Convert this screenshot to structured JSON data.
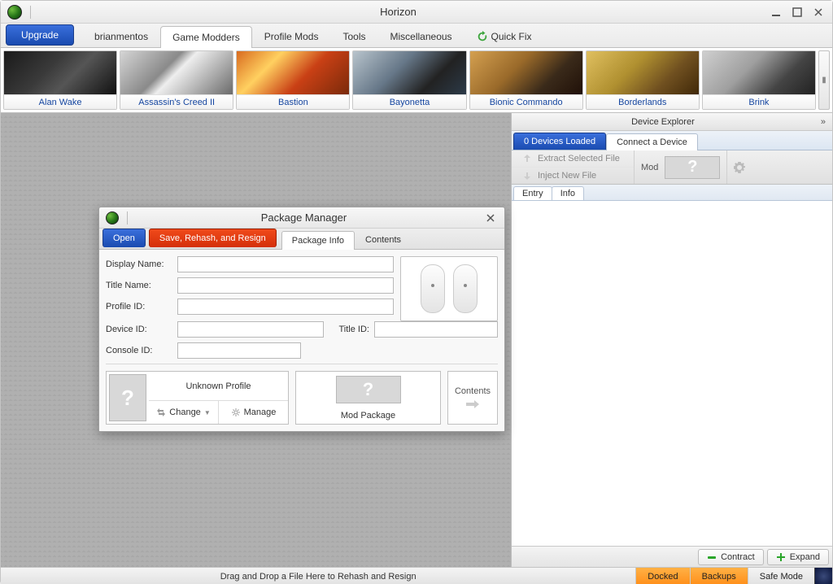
{
  "window": {
    "title": "Horizon"
  },
  "main_tabs": {
    "upgrade": "Upgrade",
    "items": [
      "brianmentos",
      "Game Modders",
      "Profile Mods",
      "Tools",
      "Miscellaneous"
    ],
    "quickfix": "Quick Fix",
    "active_index": 1
  },
  "games": [
    {
      "label": "Alan Wake"
    },
    {
      "label": "Assassin's Creed II"
    },
    {
      "label": "Bastion"
    },
    {
      "label": "Bayonetta"
    },
    {
      "label": "Bionic Commando"
    },
    {
      "label": "Borderlands"
    },
    {
      "label": "Brink"
    }
  ],
  "device_explorer": {
    "title": "Device Explorer",
    "tabs": {
      "loaded": "0 Devices Loaded",
      "connect": "Connect a Device"
    },
    "toolbar": {
      "extract": "Extract Selected File",
      "inject": "Inject New File",
      "mod": "Mod"
    },
    "subtabs": [
      "Entry",
      "Info"
    ],
    "footer": {
      "contract": "Contract",
      "expand": "Expand"
    }
  },
  "package_manager": {
    "title": "Package Manager",
    "tabs": {
      "open": "Open",
      "save": "Save, Rehash, and Resign",
      "info": "Package Info",
      "contents": "Contents"
    },
    "fields": {
      "display_name": "Display Name:",
      "title_name": "Title Name:",
      "profile_id": "Profile ID:",
      "device_id": "Device ID:",
      "title_id": "Title ID:",
      "console_id": "Console ID:"
    },
    "values": {
      "display_name": "",
      "title_name": "",
      "profile_id": "",
      "device_id": "",
      "title_id": "",
      "console_id": ""
    },
    "profile": {
      "name": "Unknown Profile",
      "change": "Change",
      "manage": "Manage"
    },
    "mod_package": "Mod Package",
    "contents_btn": "Contents"
  },
  "statusbar": {
    "message": "Drag and Drop a File Here to Rehash and Resign",
    "docked": "Docked",
    "backups": "Backups",
    "safemode": "Safe Mode"
  }
}
